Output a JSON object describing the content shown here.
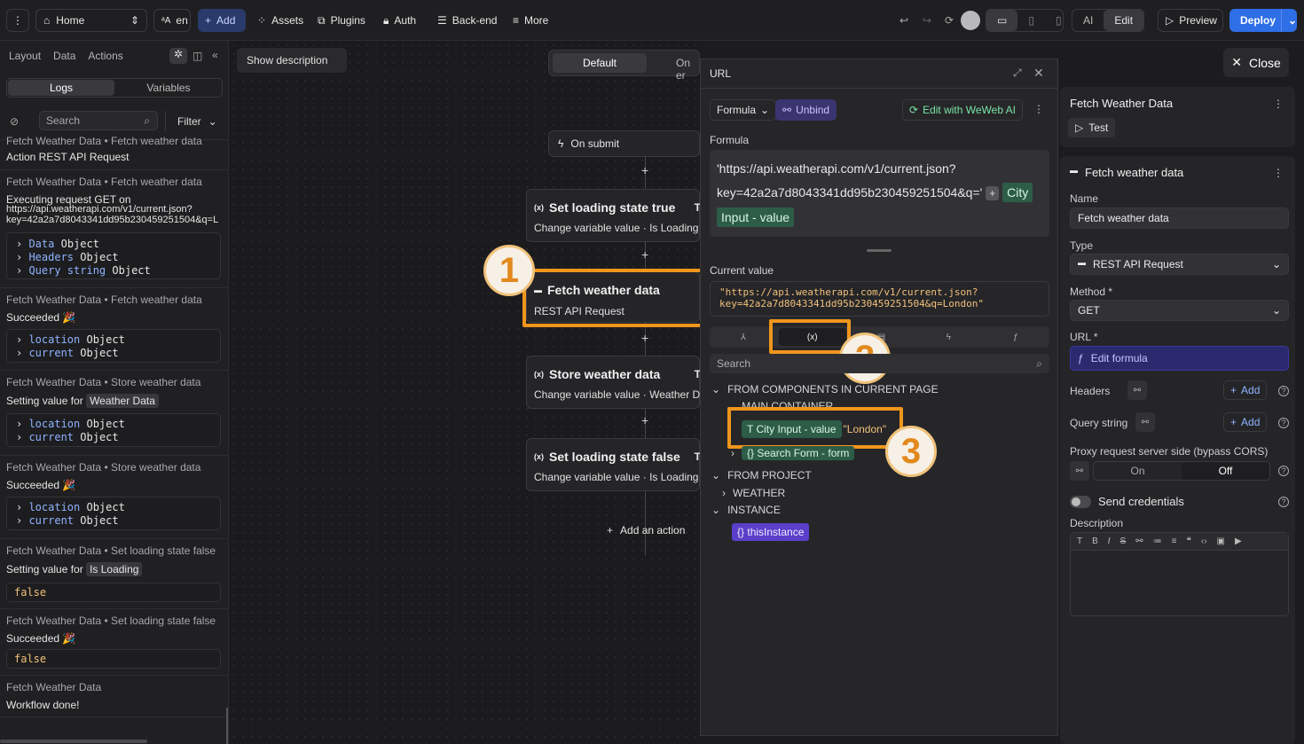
{
  "topbar": {
    "home": "Home",
    "lang": "en",
    "add": "Add",
    "assets": "Assets",
    "plugins": "Plugins",
    "auth": "Auth",
    "backend": "Back-end",
    "more": "More",
    "ai": "AI",
    "edit": "Edit",
    "preview": "Preview",
    "deploy": "Deploy"
  },
  "left": {
    "tabs": [
      "Layout",
      "Data",
      "Actions"
    ],
    "subtabs": [
      "Logs",
      "Variables"
    ],
    "search_placeholder": "Search",
    "filter": "Filter",
    "partial_header": "Fetch Weather Data • Fetch weather data",
    "partial_text": "Action REST API Request",
    "logs": [
      {
        "header": "Fetch Weather Data • Fetch weather data",
        "text": "Executing request GET on",
        "url1": "https://api.weatherapi.com/v1/current.json?",
        "url2": "key=42a2a7d8043341dd95b230459251504&q=L"
      },
      {
        "header": "Fetch Weather Data • Fetch weather data",
        "text": "Succeeded 🎉"
      },
      {
        "header": "Fetch Weather Data • Store weather data",
        "text": "Setting value for",
        "chip": "Weather Data"
      },
      {
        "header": "Fetch Weather Data • Store weather data",
        "text": "Succeeded 🎉"
      },
      {
        "header": "Fetch Weather Data • Set loading state false",
        "text": "Setting value for",
        "chip": "Is Loading",
        "value": "false"
      },
      {
        "header": "Fetch Weather Data • Set loading state false",
        "text": "Succeeded 🎉",
        "value": "false"
      },
      {
        "header": "Fetch Weather Data",
        "text": "Workflow done!"
      }
    ],
    "obj_data": {
      "k": "Data",
      "t": "Object"
    },
    "obj_headers": {
      "k": "Headers",
      "t": "Object"
    },
    "obj_query": {
      "k": "Query string",
      "t": "Object"
    },
    "obj_location": {
      "k": "location",
      "t": "Object"
    },
    "obj_current": {
      "k": "current",
      "t": "Object"
    }
  },
  "canvas": {
    "show_description": "Show description",
    "tab_default": "Default",
    "tab_on": "On er",
    "on_submit": "On submit",
    "nodes": [
      {
        "title": "Set loading state true",
        "sub": "Change variable value · Is Loading"
      },
      {
        "title": "Fetch weather data",
        "sub": "REST API Request"
      },
      {
        "title": "Store weather data",
        "sub": "Change variable value · Weather Dat"
      },
      {
        "title": "Set loading state false",
        "sub": "Change variable value · Is Loading"
      }
    ],
    "add_action": "Add an action",
    "badges": [
      "1",
      "2",
      "3"
    ]
  },
  "modal": {
    "title": "URL",
    "formula_btn": "Formula",
    "unbind": "Unbind",
    "edit_ai": "Edit with WeWeb AI",
    "formula_label": "Formula",
    "formula_line1": "'https://api.weatherapi.com/v1/current.json?",
    "formula_line2": "key=42a2a7d8043341dd95b230459251504&q='",
    "formula_plus": "+",
    "formula_token_a": "City",
    "formula_token_b": "Input - value",
    "current_value_label": "Current value",
    "current_value_1": "\"https://api.weatherapi.com/v1/current.json?",
    "current_value_2": "key=42a2a7d8043341dd95b230459251504&q=London\"",
    "search_placeholder": "Search",
    "from_components": "FROM COMPONENTS IN CURRENT PAGE",
    "main_container": "MAIN CONTAINER",
    "city_input": "City Input - value",
    "city_value": "\"London\"",
    "search_form": "Search Form - form",
    "from_project": "FROM PROJECT",
    "weather": "WEATHER",
    "instance": "INSTANCE",
    "this_instance": "thisInstance"
  },
  "right": {
    "close": "Close",
    "workflow_title": "Fetch Weather Data",
    "test": "Test",
    "action_title": "Fetch weather data",
    "name_label": "Name",
    "name_value": "Fetch weather data",
    "type_label": "Type",
    "type_value": "REST API Request",
    "method_label": "Method *",
    "method_value": "GET",
    "url_label": "URL *",
    "edit_formula": "Edit formula",
    "headers_label": "Headers",
    "query_label": "Query string",
    "add": "Add",
    "proxy_label": "Proxy request server side (bypass CORS)",
    "on": "On",
    "off": "Off",
    "send_credentials": "Send credentials",
    "description_label": "Description"
  }
}
